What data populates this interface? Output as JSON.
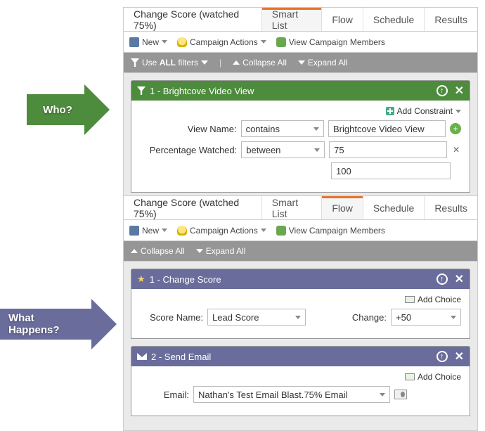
{
  "topPanel": {
    "title": "Change Score (watched 75%)",
    "tabs": {
      "smartList": "Smart List",
      "flow": "Flow",
      "schedule": "Schedule",
      "results": "Results"
    },
    "toolbar": {
      "new": "New",
      "campaignActions": "Campaign Actions",
      "viewMembers": "View Campaign Members"
    },
    "filterbar": {
      "use_prefix": "Use ",
      "use_all": "ALL",
      "use_suffix": " filters",
      "collapse": "Collapse All",
      "expand": "Expand All"
    },
    "card1": {
      "title": "1 - Brightcove Video View",
      "addConstraint": "Add Constraint",
      "row1": {
        "label": "View Name:",
        "op": "contains",
        "val": "Brightcove Video View"
      },
      "row2": {
        "label": "Percentage Watched:",
        "op": "between",
        "val1": "75",
        "val2": "100"
      }
    }
  },
  "bottomPanel": {
    "title": "Change Score (watched 75%)",
    "tabs": {
      "smartList": "Smart List",
      "flow": "Flow",
      "schedule": "Schedule",
      "results": "Results"
    },
    "toolbar": {
      "new": "New",
      "campaignActions": "Campaign Actions",
      "viewMembers": "View Campaign Members"
    },
    "filterbar": {
      "collapse": "Collapse All",
      "expand": "Expand All"
    },
    "card1": {
      "title": "1 - Change Score",
      "addChoice": "Add Choice",
      "row": {
        "label1": "Score Name:",
        "val1": "Lead Score",
        "label2": "Change:",
        "val2": "+50"
      }
    },
    "card2": {
      "title": "2 - Send Email",
      "addChoice": "Add Choice",
      "row": {
        "label": "Email:",
        "val": "Nathan's Test Email Blast.75% Email"
      }
    }
  },
  "annotations": {
    "who": "Who?",
    "what": "What Happens?"
  }
}
